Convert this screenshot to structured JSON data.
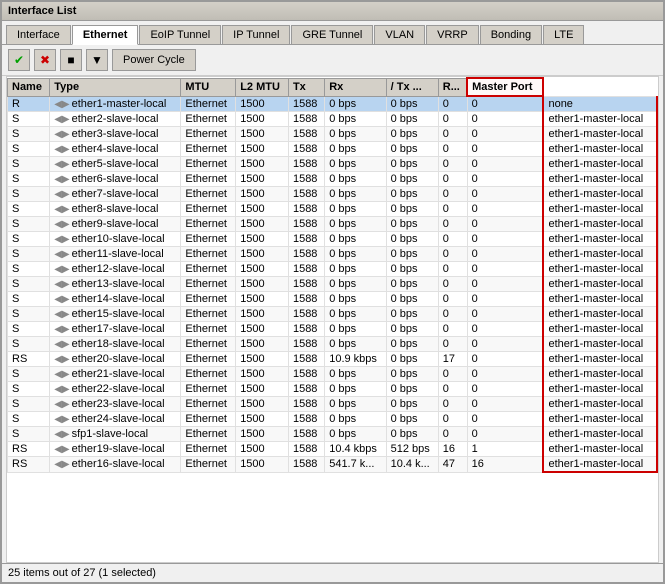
{
  "window": {
    "title": "Interface List"
  },
  "tabs": [
    {
      "label": "Interface",
      "active": false
    },
    {
      "label": "Ethernet",
      "active": true
    },
    {
      "label": "EoIP Tunnel",
      "active": false
    },
    {
      "label": "IP Tunnel",
      "active": false
    },
    {
      "label": "GRE Tunnel",
      "active": false
    },
    {
      "label": "VLAN",
      "active": false
    },
    {
      "label": "VRRP",
      "active": false
    },
    {
      "label": "Bonding",
      "active": false
    },
    {
      "label": "LTE",
      "active": false
    }
  ],
  "toolbar": {
    "power_cycle_label": "Power Cycle"
  },
  "table": {
    "headers": [
      "Name",
      "Type",
      "MTU",
      "L2 MTU",
      "Tx",
      "Rx",
      "/ Tx ...",
      "R...",
      "Master Port"
    ],
    "rows": [
      {
        "status": "R",
        "name": "ether1-master-local",
        "type": "Ethernet",
        "mtu": "1500",
        "l2mtu": "1588",
        "tx": "0 bps",
        "rx": "0 bps",
        "tx2": "0",
        "r": "0",
        "master": "none",
        "selected": true
      },
      {
        "status": "S",
        "name": "ether2-slave-local",
        "type": "Ethernet",
        "mtu": "1500",
        "l2mtu": "1588",
        "tx": "0 bps",
        "rx": "0 bps",
        "tx2": "0",
        "r": "0",
        "master": "ether1-master-local"
      },
      {
        "status": "S",
        "name": "ether3-slave-local",
        "type": "Ethernet",
        "mtu": "1500",
        "l2mtu": "1588",
        "tx": "0 bps",
        "rx": "0 bps",
        "tx2": "0",
        "r": "0",
        "master": "ether1-master-local"
      },
      {
        "status": "S",
        "name": "ether4-slave-local",
        "type": "Ethernet",
        "mtu": "1500",
        "l2mtu": "1588",
        "tx": "0 bps",
        "rx": "0 bps",
        "tx2": "0",
        "r": "0",
        "master": "ether1-master-local"
      },
      {
        "status": "S",
        "name": "ether5-slave-local",
        "type": "Ethernet",
        "mtu": "1500",
        "l2mtu": "1588",
        "tx": "0 bps",
        "rx": "0 bps",
        "tx2": "0",
        "r": "0",
        "master": "ether1-master-local"
      },
      {
        "status": "S",
        "name": "ether6-slave-local",
        "type": "Ethernet",
        "mtu": "1500",
        "l2mtu": "1588",
        "tx": "0 bps",
        "rx": "0 bps",
        "tx2": "0",
        "r": "0",
        "master": "ether1-master-local"
      },
      {
        "status": "S",
        "name": "ether7-slave-local",
        "type": "Ethernet",
        "mtu": "1500",
        "l2mtu": "1588",
        "tx": "0 bps",
        "rx": "0 bps",
        "tx2": "0",
        "r": "0",
        "master": "ether1-master-local"
      },
      {
        "status": "S",
        "name": "ether8-slave-local",
        "type": "Ethernet",
        "mtu": "1500",
        "l2mtu": "1588",
        "tx": "0 bps",
        "rx": "0 bps",
        "tx2": "0",
        "r": "0",
        "master": "ether1-master-local"
      },
      {
        "status": "S",
        "name": "ether9-slave-local",
        "type": "Ethernet",
        "mtu": "1500",
        "l2mtu": "1588",
        "tx": "0 bps",
        "rx": "0 bps",
        "tx2": "0",
        "r": "0",
        "master": "ether1-master-local"
      },
      {
        "status": "S",
        "name": "ether10-slave-local",
        "type": "Ethernet",
        "mtu": "1500",
        "l2mtu": "1588",
        "tx": "0 bps",
        "rx": "0 bps",
        "tx2": "0",
        "r": "0",
        "master": "ether1-master-local"
      },
      {
        "status": "S",
        "name": "ether11-slave-local",
        "type": "Ethernet",
        "mtu": "1500",
        "l2mtu": "1588",
        "tx": "0 bps",
        "rx": "0 bps",
        "tx2": "0",
        "r": "0",
        "master": "ether1-master-local"
      },
      {
        "status": "S",
        "name": "ether12-slave-local",
        "type": "Ethernet",
        "mtu": "1500",
        "l2mtu": "1588",
        "tx": "0 bps",
        "rx": "0 bps",
        "tx2": "0",
        "r": "0",
        "master": "ether1-master-local"
      },
      {
        "status": "S",
        "name": "ether13-slave-local",
        "type": "Ethernet",
        "mtu": "1500",
        "l2mtu": "1588",
        "tx": "0 bps",
        "rx": "0 bps",
        "tx2": "0",
        "r": "0",
        "master": "ether1-master-local"
      },
      {
        "status": "S",
        "name": "ether14-slave-local",
        "type": "Ethernet",
        "mtu": "1500",
        "l2mtu": "1588",
        "tx": "0 bps",
        "rx": "0 bps",
        "tx2": "0",
        "r": "0",
        "master": "ether1-master-local"
      },
      {
        "status": "S",
        "name": "ether15-slave-local",
        "type": "Ethernet",
        "mtu": "1500",
        "l2mtu": "1588",
        "tx": "0 bps",
        "rx": "0 bps",
        "tx2": "0",
        "r": "0",
        "master": "ether1-master-local"
      },
      {
        "status": "S",
        "name": "ether17-slave-local",
        "type": "Ethernet",
        "mtu": "1500",
        "l2mtu": "1588",
        "tx": "0 bps",
        "rx": "0 bps",
        "tx2": "0",
        "r": "0",
        "master": "ether1-master-local"
      },
      {
        "status": "S",
        "name": "ether18-slave-local",
        "type": "Ethernet",
        "mtu": "1500",
        "l2mtu": "1588",
        "tx": "0 bps",
        "rx": "0 bps",
        "tx2": "0",
        "r": "0",
        "master": "ether1-master-local"
      },
      {
        "status": "RS",
        "name": "ether20-slave-local",
        "type": "Ethernet",
        "mtu": "1500",
        "l2mtu": "1588",
        "tx": "10.9 kbps",
        "rx": "0 bps",
        "tx2": "17",
        "r": "0",
        "master": "ether1-master-local"
      },
      {
        "status": "S",
        "name": "ether21-slave-local",
        "type": "Ethernet",
        "mtu": "1500",
        "l2mtu": "1588",
        "tx": "0 bps",
        "rx": "0 bps",
        "tx2": "0",
        "r": "0",
        "master": "ether1-master-local"
      },
      {
        "status": "S",
        "name": "ether22-slave-local",
        "type": "Ethernet",
        "mtu": "1500",
        "l2mtu": "1588",
        "tx": "0 bps",
        "rx": "0 bps",
        "tx2": "0",
        "r": "0",
        "master": "ether1-master-local"
      },
      {
        "status": "S",
        "name": "ether23-slave-local",
        "type": "Ethernet",
        "mtu": "1500",
        "l2mtu": "1588",
        "tx": "0 bps",
        "rx": "0 bps",
        "tx2": "0",
        "r": "0",
        "master": "ether1-master-local"
      },
      {
        "status": "S",
        "name": "ether24-slave-local",
        "type": "Ethernet",
        "mtu": "1500",
        "l2mtu": "1588",
        "tx": "0 bps",
        "rx": "0 bps",
        "tx2": "0",
        "r": "0",
        "master": "ether1-master-local"
      },
      {
        "status": "S",
        "name": "sfp1-slave-local",
        "type": "Ethernet",
        "mtu": "1500",
        "l2mtu": "1588",
        "tx": "0 bps",
        "rx": "0 bps",
        "tx2": "0",
        "r": "0",
        "master": "ether1-master-local"
      },
      {
        "status": "RS",
        "name": "ether19-slave-local",
        "type": "Ethernet",
        "mtu": "1500",
        "l2mtu": "1588",
        "tx": "10.4 kbps",
        "rx": "512 bps",
        "tx2": "16",
        "r": "1",
        "master": "ether1-master-local"
      },
      {
        "status": "RS",
        "name": "ether16-slave-local",
        "type": "Ethernet",
        "mtu": "1500",
        "l2mtu": "1588",
        "tx": "541.7 k...",
        "rx": "10.4 k...",
        "tx2": "47",
        "r": "16",
        "master": "ether1-master-local"
      }
    ]
  },
  "status_bar": {
    "text": "25 items out of 27 (1 selected)"
  }
}
